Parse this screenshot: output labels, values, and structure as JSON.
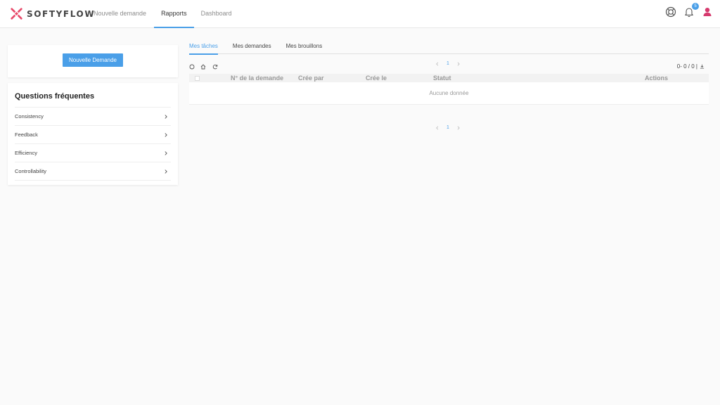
{
  "brand": {
    "name": "SOFTYFLOW",
    "accent": "#4a9fe8",
    "logo_color": "#e84a6a"
  },
  "nav": {
    "items": [
      {
        "label": "Nouvelle demande"
      },
      {
        "label": "Rapports"
      },
      {
        "label": "Dashboard"
      }
    ],
    "active": "Rapports"
  },
  "header_icons": {
    "support": "lifebuoy-icon",
    "notifications": "bell-icon",
    "notifications_count": "5",
    "user": "user-icon"
  },
  "left_panel": {
    "new_button_label": "Nouvelle Demande",
    "faq_title": "Questions fréquentes",
    "faq_items": [
      "Consistency",
      "Feedback",
      "Efficiency",
      "Controllability"
    ]
  },
  "main": {
    "tabs": [
      "Mes tâches",
      "Mes demandes",
      "Mes brouillons"
    ],
    "active_tab": "Mes tâches",
    "toolbar_icons": [
      "search-icon",
      "home-icon",
      "refresh-icon"
    ],
    "pagination_page": "1",
    "count_text": "0- 0 / 0 |",
    "table": {
      "columns": [
        "N° de la demande",
        "Crée par",
        "Crée le",
        "Statut",
        "Actions"
      ],
      "empty_text": "Aucune donnée"
    }
  }
}
